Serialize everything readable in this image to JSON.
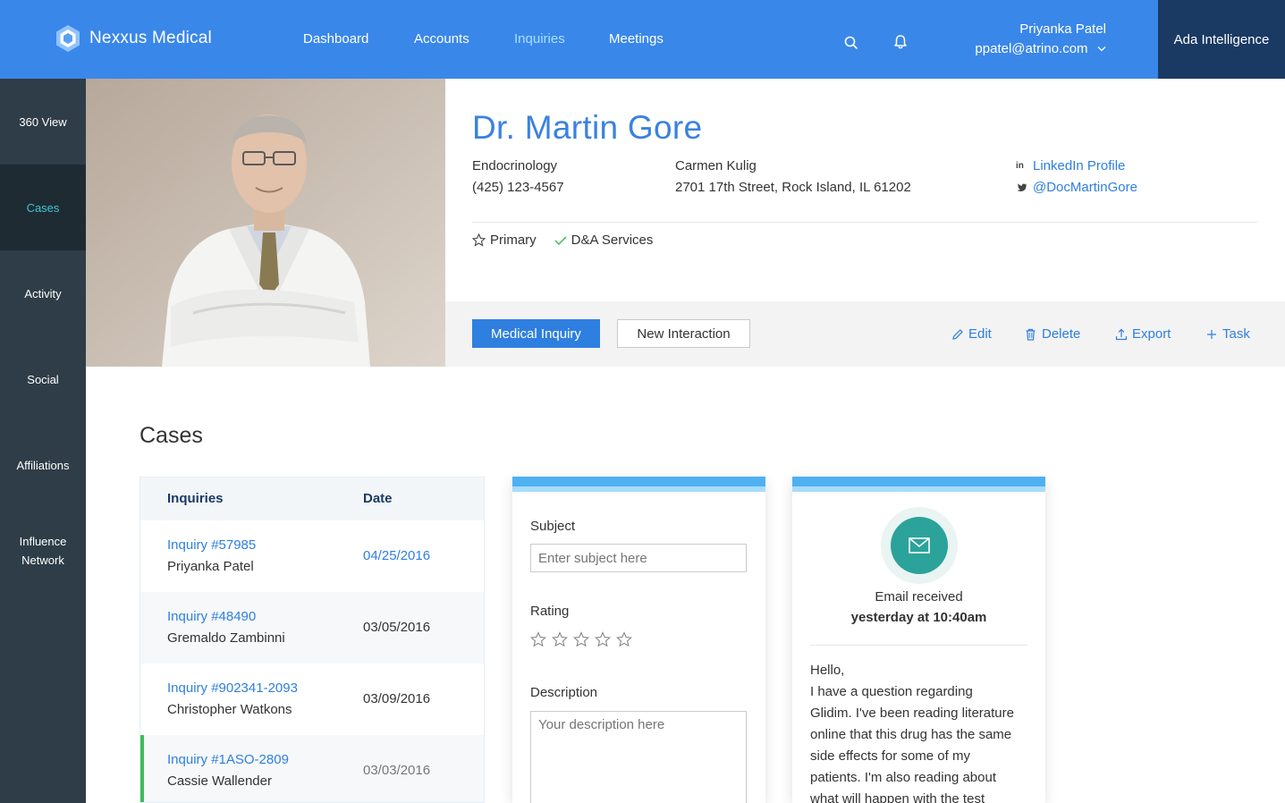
{
  "brand": {
    "name": "Nexxus Medical"
  },
  "nav": {
    "items": [
      "Dashboard",
      "Accounts",
      "Inquiries",
      "Meetings"
    ],
    "active": "Inquiries"
  },
  "user": {
    "name": "Priyanka Patel",
    "email": "ppatel@atrino.com"
  },
  "ada": {
    "label": "Ada Intelligence"
  },
  "sidebar": {
    "items": [
      {
        "label": "360 View"
      },
      {
        "label": "Cases"
      },
      {
        "label": "Activity"
      },
      {
        "label": "Social"
      },
      {
        "label": "Affiliations"
      },
      {
        "label": "Influence Network"
      }
    ],
    "active": "Cases"
  },
  "profile": {
    "name": "Dr. Martin Gore",
    "specialty": "Endocrinology",
    "phone": "(425) 123-4567",
    "contact_name": "Carmen Kulig",
    "address": "2701 17th Street, Rock Island, IL 61202",
    "linkedin": "LinkedIn Profile",
    "twitter": "@DocMartinGore",
    "tags": [
      "Primary",
      "D&A Services"
    ]
  },
  "actions": {
    "primary": "Medical Inquiry",
    "secondary": "New Interaction",
    "edit": "Edit",
    "delete": "Delete",
    "export": "Export",
    "task": "Task"
  },
  "cases": {
    "title": "Cases",
    "columns": [
      "Inquiries",
      "Date"
    ],
    "rows": [
      {
        "title": "Inquiry #57985",
        "person": "Priyanka Patel",
        "date": "04/25/2016"
      },
      {
        "title": "Inquiry #48490",
        "person": "Gremaldo Zambinni",
        "date": "03/05/2016"
      },
      {
        "title": "Inquiry #902341-2093",
        "person": "Christopher Watkons",
        "date": "03/09/2016"
      },
      {
        "title": "Inquiry #1ASO-2809",
        "person": "Cassie Wallender",
        "date": "03/03/2016"
      }
    ]
  },
  "form": {
    "subject_label": "Subject",
    "subject_placeholder": "Enter subject here",
    "rating_label": "Rating",
    "description_label": "Description",
    "description_placeholder": "Your description here"
  },
  "email": {
    "status": "Email received",
    "time": "yesterday at 10:40am",
    "body_lines": [
      "Hello,",
      "I have a question regarding",
      "Glidim. I've been reading literature",
      "online that this drug has the same",
      "side effects for some of my",
      "patients. I'm also reading about",
      "what will happen with the test"
    ]
  },
  "colors": {
    "topbar": "#3a87ea",
    "ada": "#1a3a63",
    "sidebar": "#2e3d47",
    "accent_teal": "#3ec6d6",
    "link": "#2e7fe0",
    "selected_row": "#3ebd5a",
    "mail_icon_bg": "#2ba39a"
  }
}
